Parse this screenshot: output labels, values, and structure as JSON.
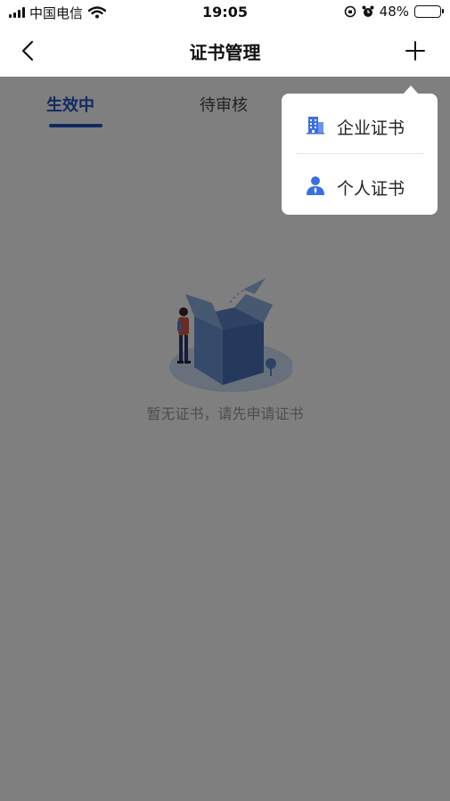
{
  "status_bar": {
    "carrier": "中国电信",
    "time": "19:05",
    "battery": "48%",
    "battery_level": 0.48
  },
  "navbar": {
    "title": "证书管理",
    "back_icon": "chevron-left-icon",
    "add_icon": "plus-icon"
  },
  "tabs": [
    {
      "label": "生效中",
      "active": true
    },
    {
      "label": "待审核",
      "active": false
    }
  ],
  "empty_state": {
    "message": "暂无证书，请先申请证书"
  },
  "popup_menu": {
    "items": [
      {
        "label": "企业证书",
        "icon": "building-icon"
      },
      {
        "label": "个人证书",
        "icon": "person-icon"
      }
    ]
  },
  "colors": {
    "accent": "#2355c0",
    "icon_blue": "#3b6fe0",
    "overlay": "rgba(0,0,0,0.5)"
  }
}
